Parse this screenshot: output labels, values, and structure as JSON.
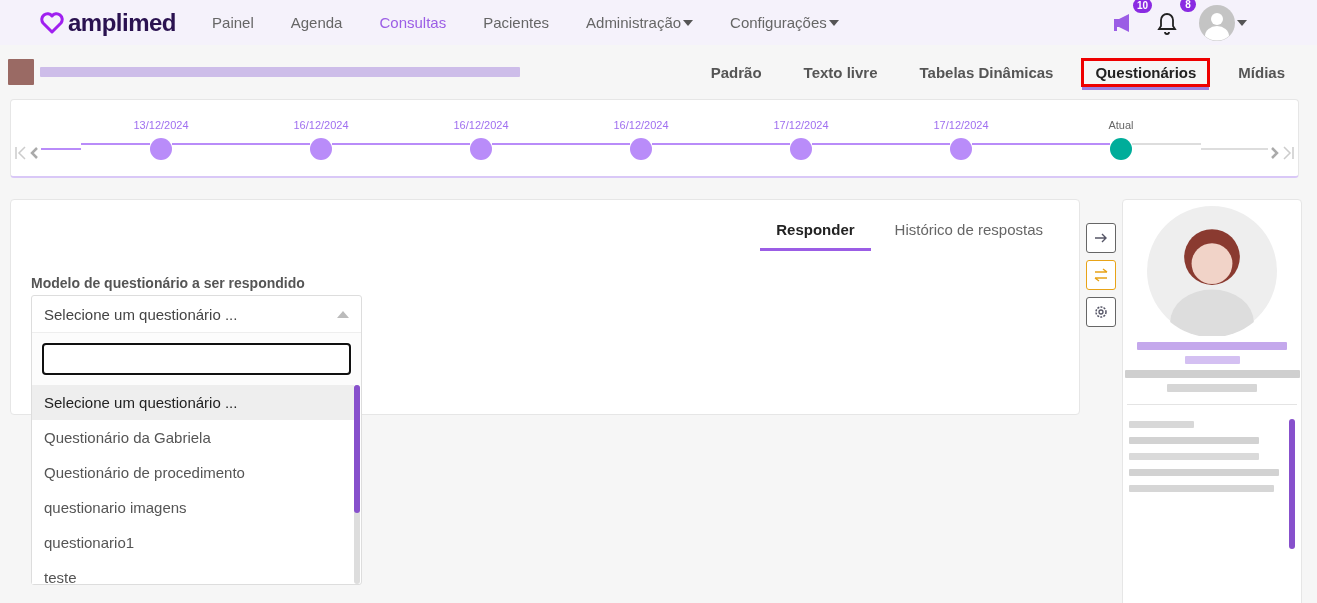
{
  "nav": {
    "logo": "amplimed",
    "items": [
      {
        "label": "Painel",
        "selected": false,
        "has_menu": false
      },
      {
        "label": "Agenda",
        "selected": false,
        "has_menu": false
      },
      {
        "label": "Consultas",
        "selected": true,
        "has_menu": false
      },
      {
        "label": "Pacientes",
        "selected": false,
        "has_menu": false
      },
      {
        "label": "Administração",
        "selected": false,
        "has_menu": true
      },
      {
        "label": "Configurações",
        "selected": false,
        "has_menu": true
      }
    ],
    "announcements_badge": "10",
    "notifications_badge": "8"
  },
  "record_tabs": [
    {
      "label": "Padrão",
      "selected": false
    },
    {
      "label": "Texto livre",
      "selected": false
    },
    {
      "label": "Tabelas Dinâmicas",
      "selected": false
    },
    {
      "label": "Questionários",
      "selected": true
    },
    {
      "label": "Mídias",
      "selected": false
    }
  ],
  "timeline": {
    "points": [
      {
        "label": "13/12/2024",
        "kind": "past"
      },
      {
        "label": "16/12/2024",
        "kind": "past"
      },
      {
        "label": "16/12/2024",
        "kind": "past"
      },
      {
        "label": "16/12/2024",
        "kind": "past"
      },
      {
        "label": "17/12/2024",
        "kind": "past"
      },
      {
        "label": "17/12/2024",
        "kind": "past"
      },
      {
        "label": "Atual",
        "kind": "current"
      }
    ]
  },
  "answer_tabs": [
    {
      "label": "Responder",
      "selected": true
    },
    {
      "label": "Histórico de respostas",
      "selected": false
    }
  ],
  "questionnaire": {
    "label": "Modelo de questionário a ser respondido",
    "value": "Selecione um questionário ...",
    "expanded": true,
    "options": [
      {
        "label": "Selecione um questionário ...",
        "selected": true
      },
      {
        "label": "Questionário da Gabriela",
        "selected": false
      },
      {
        "label": "Questionário de procedimento",
        "selected": false
      },
      {
        "label": "questionario imagens",
        "selected": false
      },
      {
        "label": "questionario1",
        "selected": false
      },
      {
        "label": "teste",
        "selected": false
      }
    ]
  }
}
